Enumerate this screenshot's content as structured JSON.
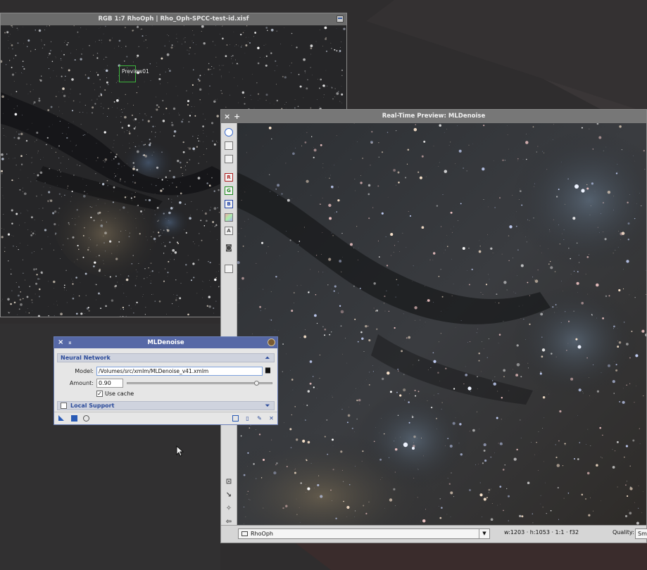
{
  "image_window": {
    "title": "RGB 1:7 RhoOph | Rho_Oph-SPCC-test-id.xisf",
    "preview_label": "Preview01"
  },
  "realtime_preview": {
    "title": "Real-Time Preview: MLDenoise",
    "close_glyph": "×",
    "add_glyph": "+",
    "toolbar": {
      "r": "R",
      "g": "G",
      "b": "B",
      "a": "A"
    },
    "status": {
      "view_name": "RhoOph",
      "dimensions": "w:1203 · h:1053 · 1:1 · f32",
      "quality_label": "Quality:",
      "quality_value": "Smo"
    }
  },
  "mldenoise": {
    "title": "MLDenoise",
    "close_glyph": "×",
    "section_neural": "Neural Network",
    "model_label": "Model:",
    "model_value": "/Volumes/src/xmlm/MLDenoise_v41.xmlm",
    "amount_label": "Amount:",
    "amount_value": "0.90",
    "amount_fraction": 0.9,
    "use_cache_label": "Use cache",
    "use_cache_checked": true,
    "section_local": "Local Support",
    "local_support_checked": false
  },
  "icons": {
    "folder": "folder-icon",
    "collapse": "collapse-arrow-icon",
    "expand": "expand-arrow-icon"
  },
  "colors": {
    "dialog_title_bg": "#5668a6",
    "section_text": "#2a4a9a",
    "preview_box": "#3db43d"
  }
}
